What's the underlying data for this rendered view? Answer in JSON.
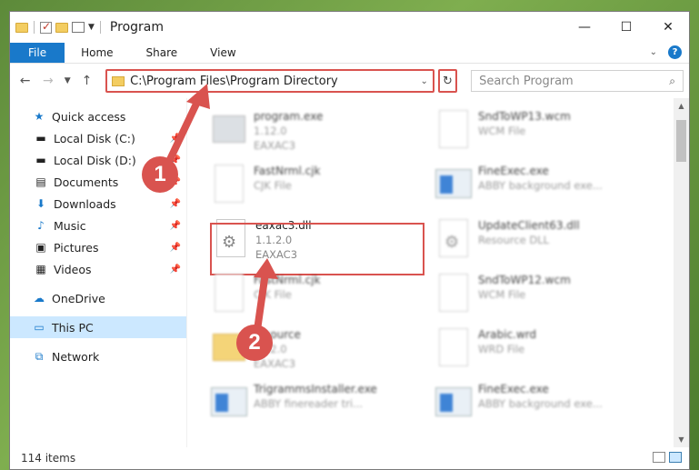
{
  "window": {
    "title": "Program",
    "controls": [
      "—",
      "☐",
      "✕"
    ]
  },
  "ribbon": {
    "tabs": [
      "File",
      "Home",
      "Share",
      "View"
    ]
  },
  "address": {
    "path": "C:\\Program Files\\Program Directory"
  },
  "search": {
    "placeholder": "Search Program"
  },
  "sidebar": {
    "items": [
      {
        "label": "Quick access",
        "icon": "star-icon"
      },
      {
        "label": "Local Disk (C:)",
        "icon": "drive-icon"
      },
      {
        "label": "Local Disk (D:)",
        "icon": "drive-icon"
      },
      {
        "label": "Documents",
        "icon": "documents-icon"
      },
      {
        "label": "Downloads",
        "icon": "downloads-icon"
      },
      {
        "label": "Music",
        "icon": "music-icon"
      },
      {
        "label": "Pictures",
        "icon": "pictures-icon"
      },
      {
        "label": "Videos",
        "icon": "videos-icon"
      },
      {
        "label": "OneDrive",
        "icon": "cloud-icon"
      },
      {
        "label": "This PC",
        "icon": "computer-icon"
      },
      {
        "label": "Network",
        "icon": "network-icon"
      }
    ]
  },
  "files": [
    {
      "name": "program.exe",
      "line2": "1.12.0",
      "line3": "EAXAC3"
    },
    {
      "name": "SndToWP13.wcm",
      "line2": "WCM File",
      "line3": ""
    },
    {
      "name": "FastNrml.cjk",
      "line2": "CJK File",
      "line3": ""
    },
    {
      "name": "FineExec.exe",
      "line2": "ABBY background exe...",
      "line3": ""
    },
    {
      "name": "eaxac3.dll",
      "line2": "1.1.2.0",
      "line3": "EAXAC3"
    },
    {
      "name": "UpdateClient63.dll",
      "line2": "Resource DLL",
      "line3": ""
    },
    {
      "name": "FastNrml.cjk",
      "line2": "CJK File",
      "line3": ""
    },
    {
      "name": "SndToWP12.wcm",
      "line2": "WCM File",
      "line3": ""
    },
    {
      "name": "resource",
      "line2": "1.12.0",
      "line3": "EAXAC3"
    },
    {
      "name": "Arabic.wrd",
      "line2": "WRD File",
      "line3": ""
    },
    {
      "name": "TrigrammsInstaller.exe",
      "line2": "ABBY finereader tri...",
      "line3": ""
    },
    {
      "name": "FineExec.exe",
      "line2": "ABBY background exe...",
      "line3": ""
    }
  ],
  "status": {
    "count": "114 items"
  },
  "annotations": {
    "marker1": "1",
    "marker2": "2",
    "accent": "#d9534f"
  }
}
